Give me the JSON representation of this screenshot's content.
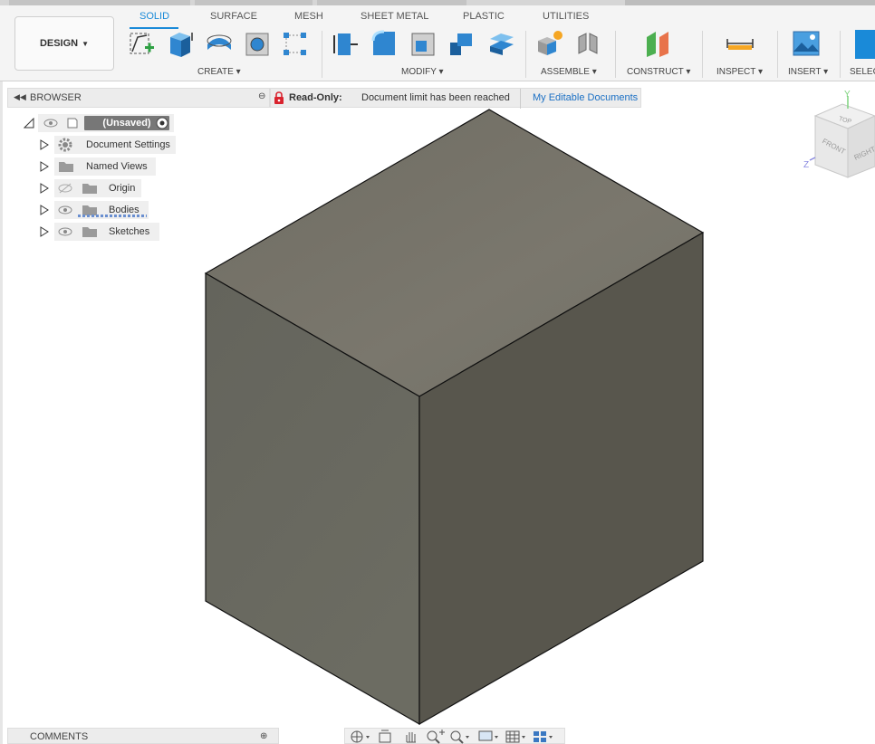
{
  "workspace": {
    "label": "DESIGN"
  },
  "tabs": [
    {
      "label": "SOLID",
      "active": true
    },
    {
      "label": "SURFACE"
    },
    {
      "label": "MESH"
    },
    {
      "label": "SHEET METAL"
    },
    {
      "label": "PLASTIC"
    },
    {
      "label": "UTILITIES"
    }
  ],
  "groups": {
    "create": "CREATE",
    "modify": "MODIFY",
    "assemble": "ASSEMBLE",
    "construct": "CONSTRUCT",
    "inspect": "INSPECT",
    "insert": "INSERT",
    "select": "SELEC"
  },
  "browser": {
    "title": "BROWSER",
    "root": "(Unsaved)",
    "items": [
      {
        "label": "Document Settings"
      },
      {
        "label": "Named Views"
      },
      {
        "label": "Origin"
      },
      {
        "label": "Bodies"
      },
      {
        "label": "Sketches"
      }
    ]
  },
  "readonly": {
    "label": "Read-Only:",
    "message": "Document limit has been reached",
    "link": "My Editable Documents"
  },
  "viewcube": {
    "top": "TOP",
    "front": "FRONT",
    "right": "RIGHT",
    "y_axis": "Y",
    "z_axis": "Z"
  },
  "comments": {
    "title": "COMMENTS"
  },
  "colors": {
    "accent": "#1a8ad8",
    "lock": "#d9232e",
    "link": "#1a6fc4",
    "cube_top": "#787568",
    "cube_front": "#66665d",
    "cube_right": "#58564d"
  }
}
